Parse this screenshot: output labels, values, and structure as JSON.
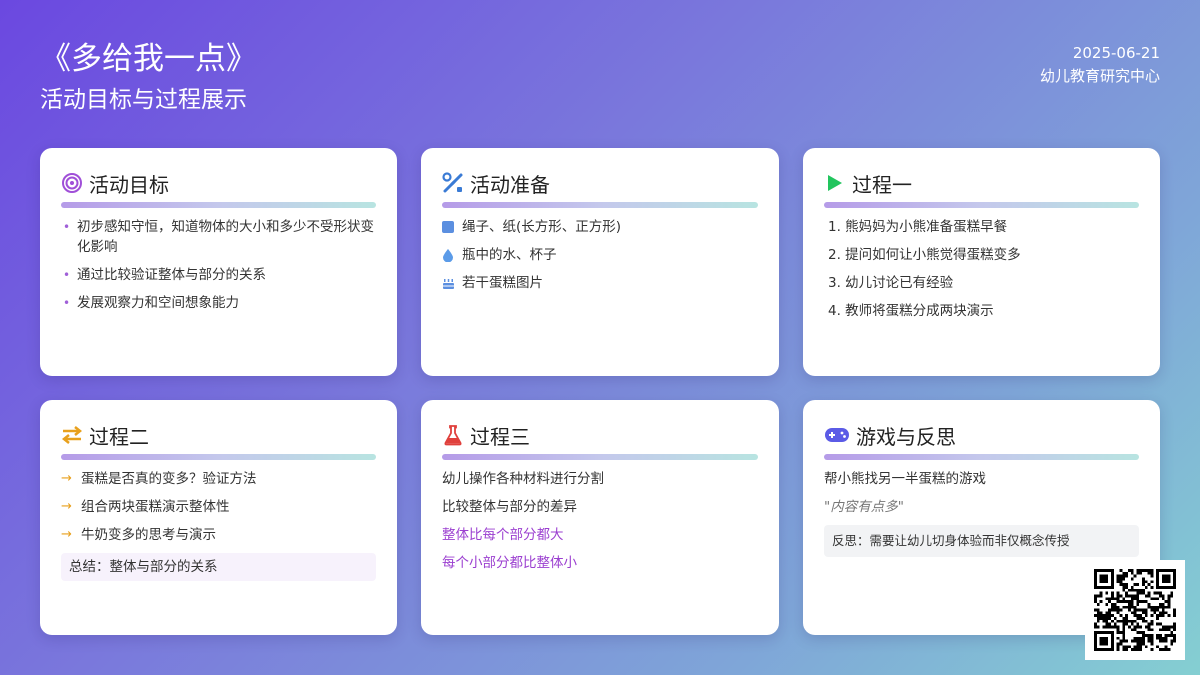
{
  "header": {
    "title": "《多给我一点》",
    "subtitle": "活动目标与过程展示",
    "date": "2025-06-21",
    "org": "幼儿教育研究中心"
  },
  "cards": {
    "goals": {
      "title": "活动目标",
      "icon": "target-icon",
      "items": [
        "初步感知守恒，知道物体的大小和多少不受形状变化影响",
        "通过比较验证整体与部分的关系",
        "发展观察力和空间想象能力"
      ]
    },
    "prep": {
      "title": "活动准备",
      "icon": "tools-icon",
      "items": [
        {
          "icon": "square-icon",
          "text": "绳子、纸(长方形、正方形)"
        },
        {
          "icon": "droplet-icon",
          "text": "瓶中的水、杯子"
        },
        {
          "icon": "cake-icon",
          "text": "若干蛋糕图片"
        }
      ]
    },
    "process1": {
      "title": "过程一",
      "icon": "play-icon",
      "items": [
        "1. 熊妈妈为小熊准备蛋糕早餐",
        "2. 提问如何让小熊觉得蛋糕变多",
        "3. 幼儿讨论已有经验",
        "4. 教师将蛋糕分成两块演示"
      ]
    },
    "process2": {
      "title": "过程二",
      "icon": "swap-arrows-icon",
      "items": [
        "蛋糕是否真的变多？验证方法",
        "组合两块蛋糕演示整体性",
        "牛奶变多的思考与演示"
      ],
      "summary": "总结：整体与部分的关系"
    },
    "process3": {
      "title": "过程三",
      "icon": "flask-icon",
      "lines": [
        "幼儿操作各种材料进行分割",
        "比较整体与部分的差异"
      ],
      "highlights": [
        "整体比每个部分都大",
        "每个小部分都比整体小"
      ]
    },
    "game": {
      "title": "游戏与反思",
      "icon": "gamepad-icon",
      "line": "帮小熊找另一半蛋糕的游戏",
      "quote": "\"内容有点多\"",
      "reflection": "反思：需要让幼儿切身体验而非仅概念传授"
    }
  },
  "colors": {
    "accent_purple": "#9b3fd0",
    "play_green": "#22c55e",
    "arrow_orange": "#e8a01c",
    "flask_red": "#e0403c",
    "tool_blue": "#3a7bd5"
  },
  "qr_icon": "qr-code-icon"
}
